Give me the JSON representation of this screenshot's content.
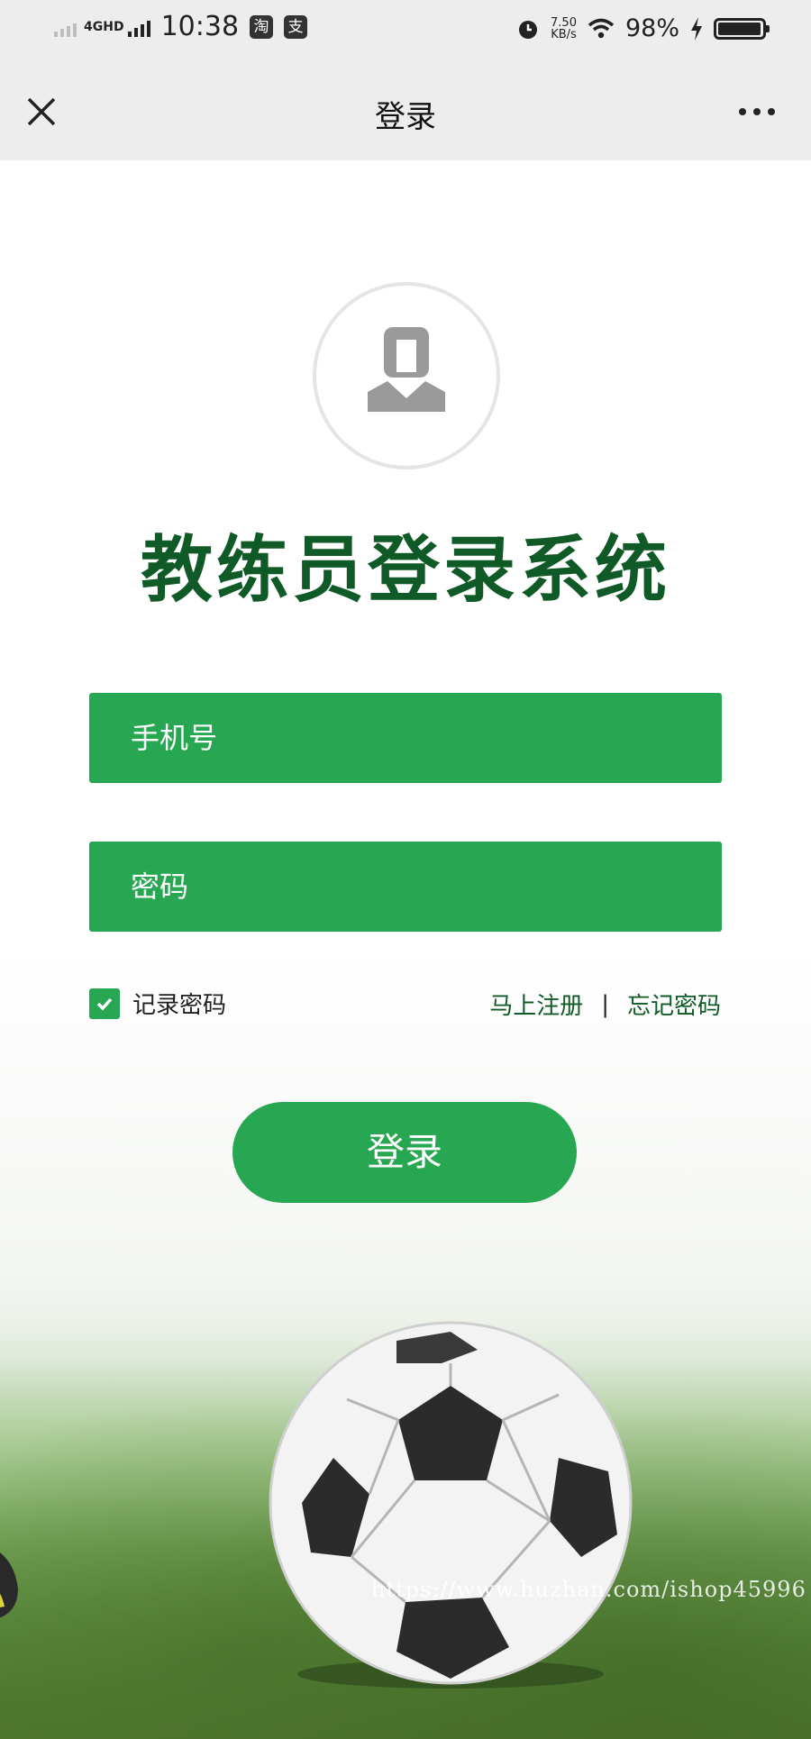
{
  "status_bar": {
    "network": "4GHD",
    "time": "10:38",
    "app_icons": [
      "淘",
      "支"
    ],
    "speed_value": "7.50",
    "speed_unit": "KB/s",
    "battery_percent": "98%",
    "battery_level": 0.98
  },
  "nav": {
    "title": "登录",
    "close_icon": "close-icon",
    "more_icon": "more-icon"
  },
  "login": {
    "app_title": "教练员登录系统",
    "phone_placeholder": "手机号",
    "password_placeholder": "密码",
    "remember_label": "记录密码",
    "remember_checked": true,
    "register_link": "马上注册",
    "separator": "|",
    "forgot_link": "忘记密码",
    "submit_label": "登录"
  },
  "watermark": "https://www.huzhan.com/ishop45996",
  "colors": {
    "primary_green": "#27a752",
    "title_green": "#0f5a26",
    "bar_gray": "#ededed"
  }
}
